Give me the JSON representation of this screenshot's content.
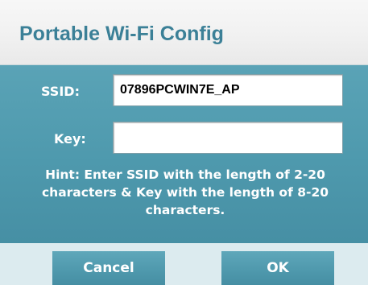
{
  "dialog": {
    "title": "Portable Wi-Fi Config",
    "ssid_label": "SSID:",
    "ssid_value": "07896PCWIN7E_AP",
    "key_label": "Key:",
    "key_value": "",
    "hint": "Hint: Enter SSID with the length of 2-20 characters & Key with the length of 8-20 characters.",
    "cancel_label": "Cancel",
    "ok_label": "OK"
  },
  "colors": {
    "title_text": "#3b8097",
    "panel": "#4f9aae",
    "footer": "#dcebef",
    "button": "#4e98ac"
  }
}
